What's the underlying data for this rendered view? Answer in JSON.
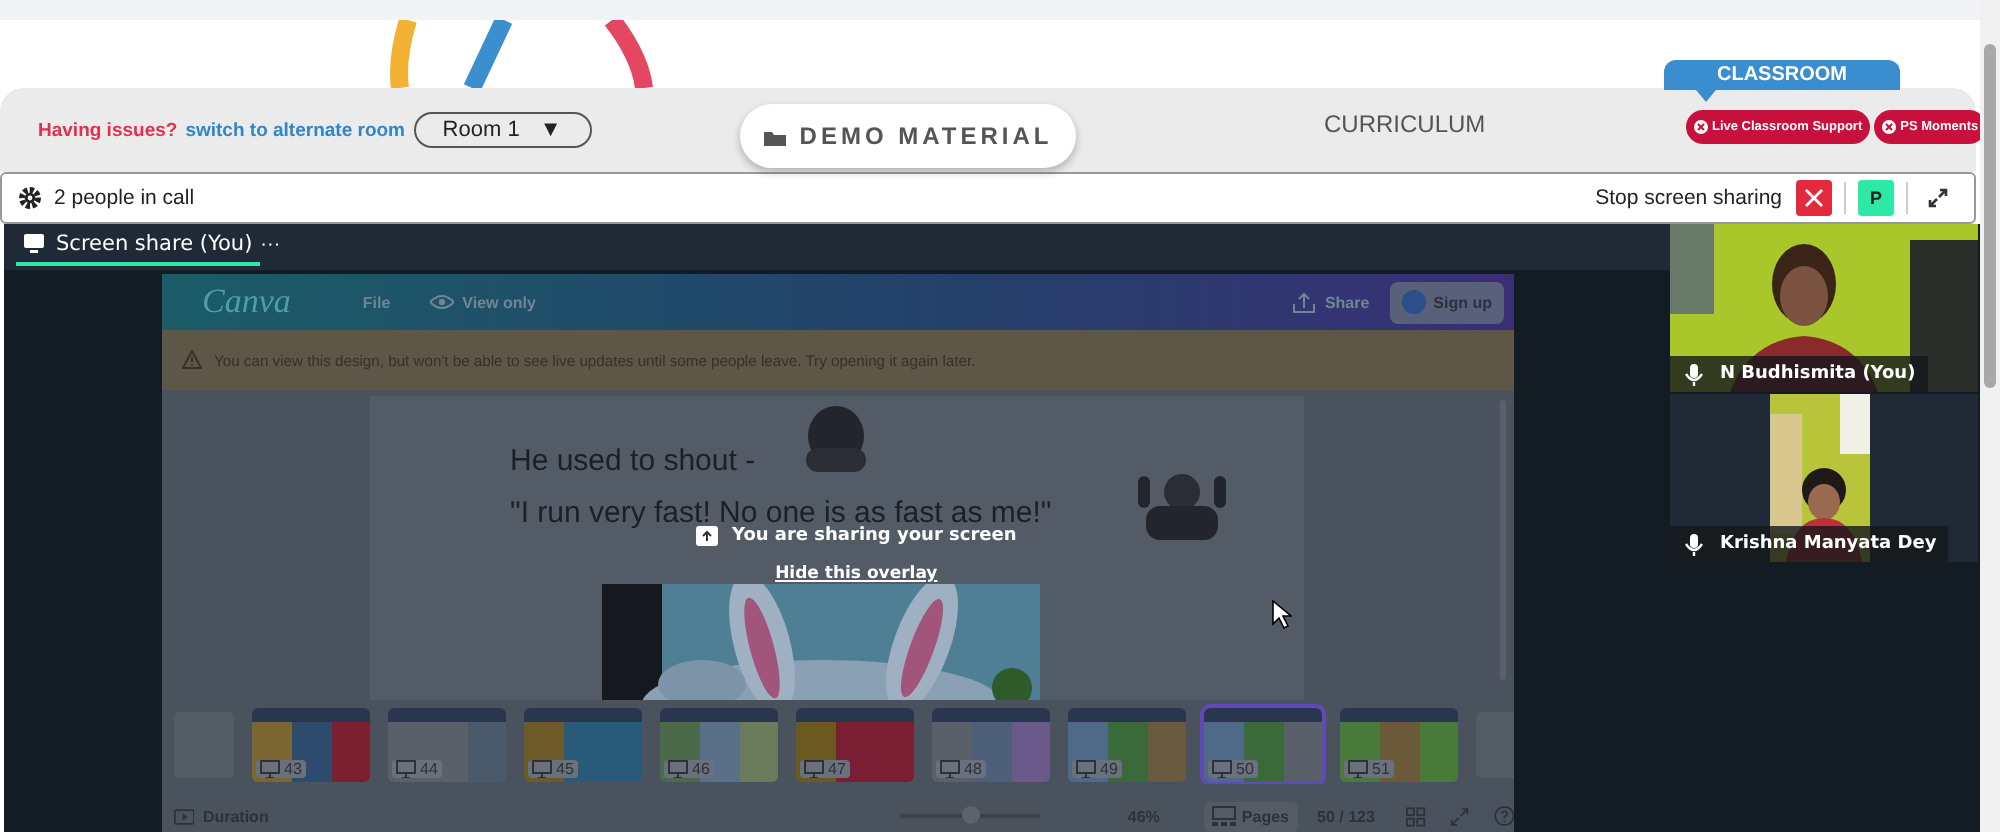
{
  "header": {
    "notice": "Having issues?",
    "switch_link": "switch to alternate room",
    "room_select": {
      "value": "Room 1",
      "caret": "▼"
    },
    "nav_tabs": [
      {
        "label": "DEMO MATERIAL",
        "selected": true
      },
      {
        "label": "CURRICULUM",
        "selected": false
      }
    ],
    "section_label": "CLASSROOM",
    "buttons": [
      "Live Classroom Support",
      "PS Moments"
    ]
  },
  "call_bar": {
    "people": "2 people in call",
    "stop_sharing": "Stop screen sharing",
    "avatar": "P"
  },
  "share_tab": {
    "label": "Screen share (You)",
    "menu": "···",
    "selected": true
  },
  "shared_screen": {
    "logo": "Canva",
    "menu": "File",
    "view_mode": "View only",
    "share": "Share",
    "sign_up": "Sign up",
    "warning": "You can view this design, but won't be able to see live updates until some people leave. Try opening it again later.",
    "slide_lines": [
      "He used to shout -",
      "\"I run very fast! No one is as fast as me!\""
    ],
    "thumbnails": [
      {
        "page": "43",
        "selected": false
      },
      {
        "page": "44",
        "selected": false
      },
      {
        "page": "45",
        "selected": false
      },
      {
        "page": "46",
        "selected": false
      },
      {
        "page": "47",
        "selected": false
      },
      {
        "page": "48",
        "selected": false
      },
      {
        "page": "49",
        "selected": false
      },
      {
        "page": "50",
        "selected": true
      },
      {
        "page": "51",
        "selected": false
      }
    ],
    "footer": {
      "duration": "Duration",
      "zoom": {
        "level": 0.5
      },
      "zoom_reading": "46%",
      "pages": "Pages",
      "page_count": "50 / 123"
    }
  },
  "overlay": {
    "message": "You are sharing your screen",
    "hide_link": "Hide this overlay"
  },
  "participants": [
    {
      "name": "N Budhismita (You)",
      "kind": "full"
    },
    {
      "name": "Krishna Manyata Dey",
      "kind": "narrow"
    }
  ]
}
